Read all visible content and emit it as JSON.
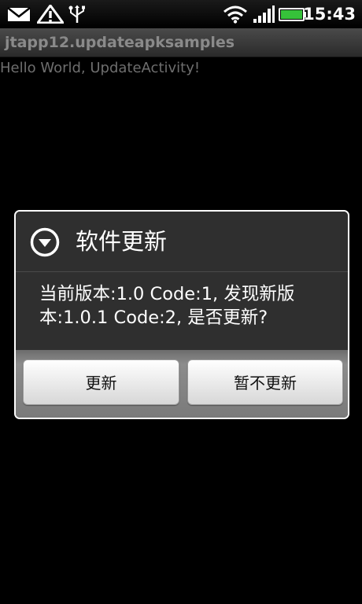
{
  "status_bar": {
    "time": "15:43",
    "icons": [
      "mail-icon",
      "warning-icon",
      "usb-icon",
      "wifi-icon",
      "signal-icon",
      "battery-icon"
    ]
  },
  "app": {
    "title": "jtapp12.updateapksamples",
    "content_text": "Hello World, UpdateActivity!"
  },
  "dialog": {
    "icon": "info-arrow-icon",
    "title": "软件更新",
    "message": "当前版本:1.0 Code:1, 发现新版本:1.0.1 Code:2, 是否更新?",
    "buttons": {
      "update": "更新",
      "not_now": "暂不更新"
    }
  },
  "colors": {
    "background": "#000000",
    "dialog_background": "#2f2f2f",
    "battery_green": "#36c23a"
  }
}
